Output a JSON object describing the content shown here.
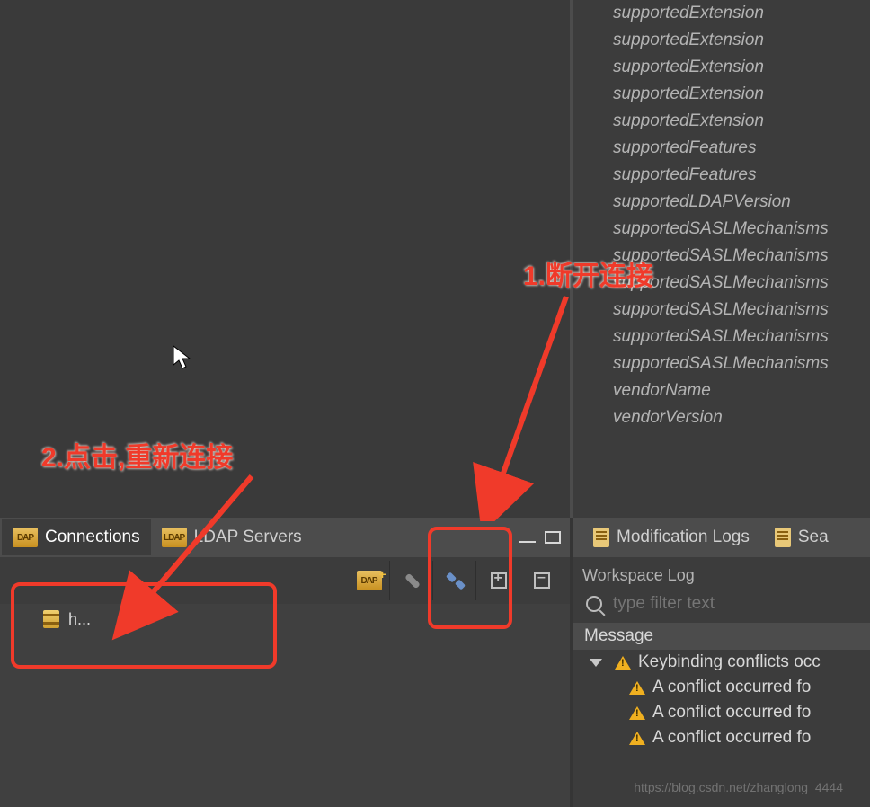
{
  "right_panel": {
    "attributes": [
      "supportedExtension",
      "supportedExtension",
      "supportedExtension",
      "supportedExtension",
      "supportedExtension",
      "supportedFeatures",
      "supportedFeatures",
      "supportedLDAPVersion",
      "supportedSASLMechanisms",
      "supportedSASLMechanisms",
      "supportedSASLMechanisms",
      "supportedSASLMechanisms",
      "supportedSASLMechanisms",
      "supportedSASLMechanisms",
      "vendorName",
      "vendorVersion"
    ]
  },
  "tabs": {
    "connections": "Connections",
    "ldap_servers": "LDAP Servers"
  },
  "connection_item": "h...",
  "right_tabs": {
    "mod_logs": "Modification Logs",
    "search": "Sea"
  },
  "logs": {
    "title": "Workspace Log",
    "filter_placeholder": "type filter text",
    "column": "Message",
    "items": [
      "Keybinding conflicts occ",
      "A conflict occurred fo",
      "A conflict occurred fo",
      "A conflict occurred fo"
    ]
  },
  "annotations": {
    "a1": "1.断开连接",
    "a2": "2.点击,重新连接"
  },
  "watermark": "https://blog.csdn.net/zhanglong_4444"
}
